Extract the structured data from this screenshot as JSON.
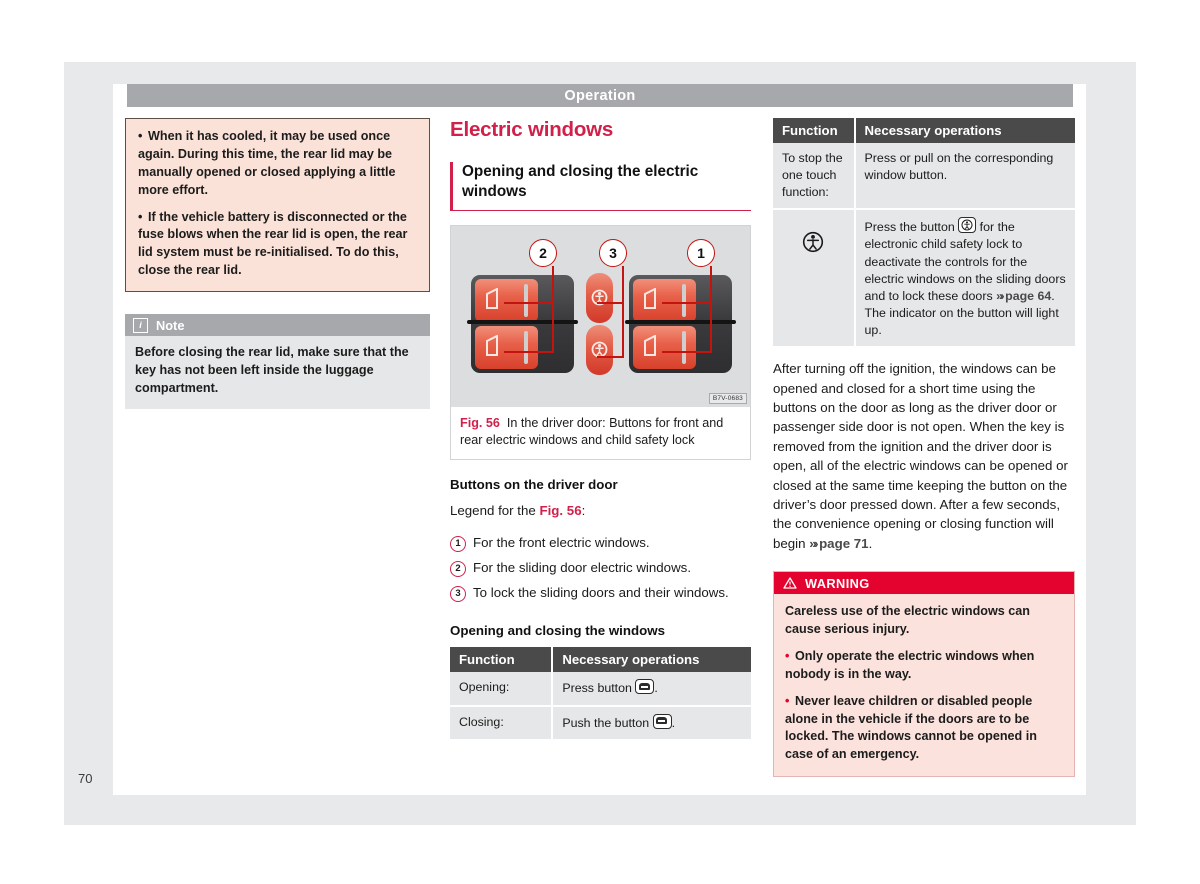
{
  "page": {
    "section_banner": "Operation",
    "page_number": "70"
  },
  "left_column": {
    "pink_box": {
      "bullets": [
        "When it has cooled, it may be used once again. During this time, the rear lid may be manually opened or closed applying a little more effort.",
        "If the vehicle battery is disconnected or the fuse blows when the rear lid is open, the rear lid system must be re-initialised. To do this, close the rear lid."
      ],
      "bullet_char": "•"
    },
    "note_box": {
      "icon": "info-icon",
      "icon_char": "i",
      "title": "Note",
      "text": "Before closing the rear lid, make sure that the key has not been left inside the luggage compartment."
    }
  },
  "middle_column": {
    "heading": "Electric windows",
    "subheading": "Opening and closing the electric windows",
    "figure": {
      "code": "B7V-0683",
      "caption_label": "Fig. 56",
      "caption_text": "In the driver door: Buttons for front and rear electric windows and child safety lock",
      "callouts": [
        "2",
        "3",
        "1"
      ]
    },
    "buttons_heading": "Buttons on the driver door",
    "legend_intro_before": "Legend for the ",
    "legend_intro_ref": "Fig. 56",
    "legend_intro_after": ":",
    "legend": [
      {
        "num": "1",
        "text": "For the front electric windows."
      },
      {
        "num": "2",
        "text": "For the sliding door electric windows."
      },
      {
        "num": "3",
        "text": "To lock the sliding doors and their windows."
      }
    ],
    "table_heading": "Opening and closing the windows",
    "table": {
      "headers": [
        "Function",
        "Necessary operations"
      ],
      "rows": [
        {
          "function": "Opening:",
          "op_before": "Press button ",
          "op_icon": "window-button-icon",
          "op_after": "."
        },
        {
          "function": "Closing:",
          "op_before": "Push the button ",
          "op_icon": "window-button-icon",
          "op_after": "."
        }
      ]
    }
  },
  "right_column": {
    "table": {
      "headers": [
        "Function",
        "Necessary operations"
      ],
      "rows": [
        {
          "function": "To stop the one touch function:",
          "function_icon": null,
          "operation": "Press or pull on the corresponding window button."
        },
        {
          "function": "",
          "function_icon": "child-safety-lock-icon",
          "op_part1": "Press the button ",
          "op_icon": "child-safety-lock-button-icon",
          "op_part2": " for the electronic child safety lock to deactivate the controls for the electric windows on the sliding doors and to lock these doors ",
          "op_ref": "page 64",
          "op_part3": ". The indicator on the button will light up."
        }
      ]
    },
    "body_text_before": "After turning off the ignition, the windows can be opened and closed for a short time using the buttons on the door as long as the driver door or passenger side door is not open. When the key is removed from the ignition and the driver door is open, all of the electric windows can be opened or closed at the same time keeping the button on the driver’s door pressed down. After a few seconds, the convenience opening or closing function will begin ",
    "body_text_ref": "page 71",
    "body_text_after": ".",
    "warning": {
      "icon": "warning-triangle-icon",
      "title": "WARNING",
      "paragraphs": [
        "Careless use of the electric windows can cause serious injury.",
        "Only operate the electric windows when nobody is in the way.",
        "Never leave children or disabled people alone in the vehicle if the doors are to be locked. The windows cannot be opened in case of an emergency."
      ],
      "bullet_char": "•"
    }
  },
  "colors": {
    "accent_red": "#d1204a",
    "warning_red": "#e4032e",
    "banner_gray": "#a6a8ab",
    "table_header": "#4a4a4a",
    "table_cell": "#e6e7e8",
    "pink_bg": "#fbe2d8"
  }
}
